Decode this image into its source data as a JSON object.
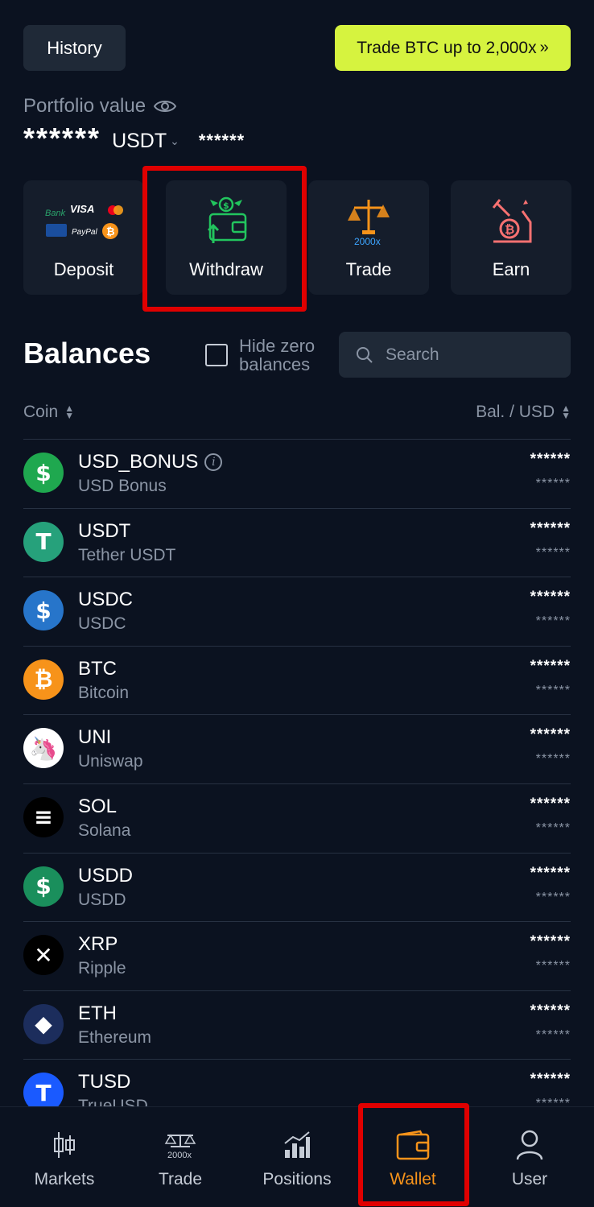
{
  "header": {
    "history_label": "History",
    "promo_label": "Trade BTC up to 2,000x",
    "promo_arrows": "»"
  },
  "portfolio": {
    "label": "Portfolio value",
    "value_masked": "******",
    "currency": "USDT",
    "sub_value_masked": "******"
  },
  "actions": [
    {
      "label": "Deposit",
      "icon": "deposit-payment-methods-icon"
    },
    {
      "label": "Withdraw",
      "icon": "wallet-withdraw-icon"
    },
    {
      "label": "Trade",
      "icon": "scale-2000x-icon",
      "badge": "2000x"
    },
    {
      "label": "Earn",
      "icon": "bitcoin-earn-icon"
    }
  ],
  "deposit_icon_text": {
    "bank": "Bank",
    "visa": "VISA",
    "paypal": "PayPal"
  },
  "balances": {
    "title": "Balances",
    "hide_zero_label": "Hide zero balances",
    "search_placeholder": "Search",
    "col_coin": "Coin",
    "col_balance": "Bal. / USD"
  },
  "coins": [
    {
      "symbol": "USD_BONUS",
      "name": "USD Bonus",
      "balance": "******",
      "usd": "******",
      "color": "#1fa84f",
      "glyph": "$",
      "info": true
    },
    {
      "symbol": "USDT",
      "name": "Tether USDT",
      "balance": "******",
      "usd": "******",
      "color": "#26a17b",
      "glyph": "T"
    },
    {
      "symbol": "USDC",
      "name": "USDC",
      "balance": "******",
      "usd": "******",
      "color": "#2775ca",
      "glyph": "$"
    },
    {
      "symbol": "BTC",
      "name": "Bitcoin",
      "balance": "******",
      "usd": "******",
      "color": "#f7931a",
      "glyph": "₿"
    },
    {
      "symbol": "UNI",
      "name": "Uniswap",
      "balance": "******",
      "usd": "******",
      "color": "#ffffff",
      "glyph": "🦄"
    },
    {
      "symbol": "SOL",
      "name": "Solana",
      "balance": "******",
      "usd": "******",
      "color": "#000000",
      "glyph": "≡"
    },
    {
      "symbol": "USDD",
      "name": "USDD",
      "balance": "******",
      "usd": "******",
      "color": "#1a8f5c",
      "glyph": "$"
    },
    {
      "symbol": "XRP",
      "name": "Ripple",
      "balance": "******",
      "usd": "******",
      "color": "#000000",
      "glyph": "✕"
    },
    {
      "symbol": "ETH",
      "name": "Ethereum",
      "balance": "******",
      "usd": "******",
      "color": "#1c2d5c",
      "glyph": "◆"
    },
    {
      "symbol": "TUSD",
      "name": "TrueUSD",
      "balance": "******",
      "usd": "******",
      "color": "#1a5aff",
      "glyph": "T"
    }
  ],
  "nav": [
    {
      "label": "Markets",
      "icon": "candlestick-icon"
    },
    {
      "label": "Trade",
      "icon": "scale-2000x-icon",
      "badge": "2000x"
    },
    {
      "label": "Positions",
      "icon": "bar-chart-icon"
    },
    {
      "label": "Wallet",
      "icon": "wallet-icon",
      "active": true
    },
    {
      "label": "User",
      "icon": "user-icon"
    }
  ],
  "colors": {
    "background": "#0b1220",
    "card": "#151d2b",
    "promo": "#d6f33f",
    "active": "#f7931a",
    "muted": "#8b95a5",
    "annotation": "#e00000"
  }
}
